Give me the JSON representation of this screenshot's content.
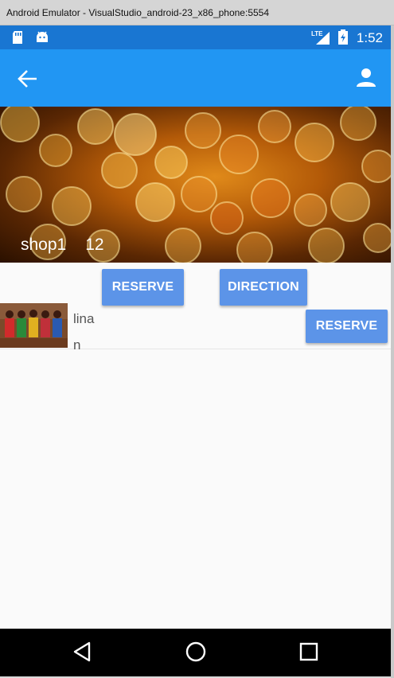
{
  "window": {
    "title": "Android Emulator - VisualStudio_android-23_x86_phone:5554"
  },
  "status_bar": {
    "time": "1:52",
    "network": "LTE",
    "color": "#1976d2"
  },
  "app_bar": {
    "color": "#2196f3"
  },
  "hero": {
    "name": "shop1",
    "number": "12"
  },
  "actions": {
    "reserve_label": "RESERVE",
    "direction_label": "DIRECTION"
  },
  "list": {
    "items": [
      {
        "name": "linan",
        "action_label": "RESERVE"
      }
    ]
  },
  "accent": "#5c94e8"
}
